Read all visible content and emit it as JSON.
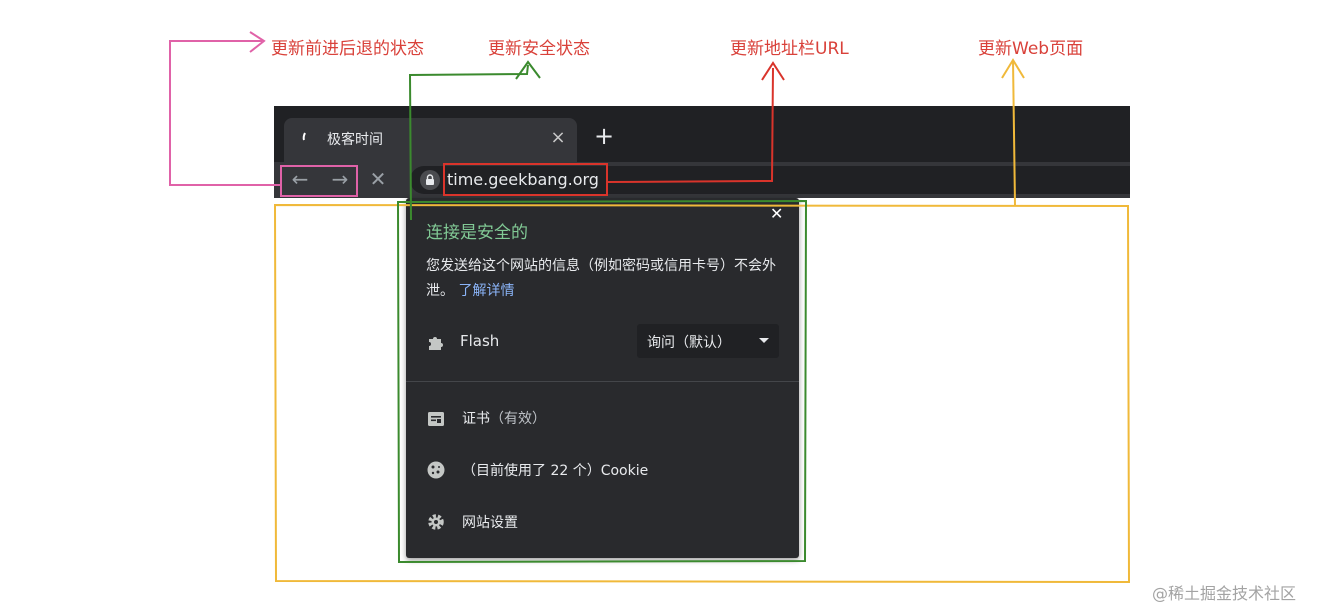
{
  "annotations": {
    "nav_state": "更新前进后退的状态",
    "security_state": "更新安全状态",
    "address_bar": "更新地址栏URL",
    "web_page": "更新Web页面"
  },
  "browser": {
    "tab": {
      "title": "极客时间",
      "close_icon": "×"
    },
    "new_tab": "+",
    "toolbar": {
      "back_icon": "←",
      "forward_icon": "→",
      "stop_icon": "✕",
      "url": "time.geekbang.org"
    }
  },
  "popup": {
    "close_icon": "✕",
    "title": "连接是安全的",
    "description": "您发送给这个网站的信息（例如密码或信用卡号）不会外泄。",
    "learn_more": "了解详情",
    "flash": {
      "label": "Flash",
      "select_value": "询问（默认）"
    },
    "certificate": {
      "label": "证书",
      "status": "（有效）"
    },
    "cookies": {
      "label": "（目前使用了 22 个）Cookie"
    },
    "site_settings": {
      "label": "网站设置"
    }
  },
  "colors": {
    "pink": "#e062a8",
    "green": "#3b8a2e",
    "red": "#d9342b",
    "yellow": "#f0b93a"
  },
  "watermark": "@稀土掘金技术社区"
}
